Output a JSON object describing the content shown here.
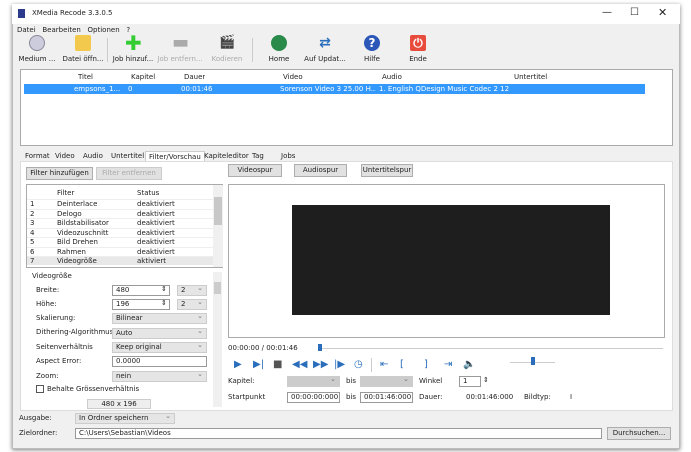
{
  "window": {
    "title": "XMedia Recode 3.3.0.5"
  },
  "menu": [
    "Datei",
    "Bearbeiten",
    "Optionen",
    "?"
  ],
  "toolbar": [
    {
      "label": "Medium ...",
      "icon": "disc-icon",
      "enabled": true
    },
    {
      "label": "Datei öffn...",
      "icon": "folder-open-icon",
      "enabled": true
    },
    {
      "label": "Job hinzuf...",
      "icon": "plus-icon",
      "enabled": true
    },
    {
      "label": "Job entfern...",
      "icon": "minus-icon",
      "enabled": false
    },
    {
      "label": "Kodieren",
      "icon": "film-encode-icon",
      "enabled": false
    },
    {
      "label": "Home",
      "icon": "globe-icon",
      "enabled": true
    },
    {
      "label": "Auf Updat...",
      "icon": "refresh-icon",
      "enabled": true
    },
    {
      "label": "Hilfe",
      "icon": "help-icon",
      "enabled": true
    },
    {
      "label": "Ende",
      "icon": "power-icon",
      "enabled": true
    }
  ],
  "filelist": {
    "columns": [
      "Titel",
      "Kapitel",
      "Dauer",
      "Video",
      "Audio",
      "Untertitel"
    ],
    "rows": [
      [
        "empsons_1...",
        "0",
        "00:01:46",
        "Sorenson Video 3 25.00 H...",
        "1. English QDesign Music Codec 2 12...",
        ""
      ]
    ]
  },
  "tabs": [
    "Format",
    "Video",
    "Audio",
    "Untertitel",
    "Filter/Vorschau",
    "Kapiteleditor",
    "Tag",
    "Jobs"
  ],
  "active_tab": "Filter/Vorschau",
  "filter": {
    "add_label": "Filter hinzufügen",
    "remove_label": "Filter entfernen",
    "columns": [
      "Filter",
      "Status"
    ],
    "rows": [
      [
        "1",
        "Deinterlace",
        "deaktiviert"
      ],
      [
        "2",
        "Delogo",
        "deaktiviert"
      ],
      [
        "3",
        "Bildstabilisator",
        "deaktiviert"
      ],
      [
        "4",
        "Videozuschnitt",
        "deaktiviert"
      ],
      [
        "5",
        "Bild Drehen",
        "deaktiviert"
      ],
      [
        "6",
        "Rahmen",
        "deaktiviert"
      ],
      [
        "7",
        "Videogröße",
        "aktiviert"
      ]
    ]
  },
  "videosize": {
    "title": "Videogröße",
    "width_label": "Breite:",
    "width": "480",
    "width_div": "2",
    "height_label": "Höhe:",
    "height": "196",
    "height_div": "2",
    "scaling_label": "Skalierung:",
    "scaling": "Bilinear",
    "dither_label": "Dithering-Algorithmus",
    "dither": "Auto",
    "aspect_label": "Seitenverhältnis",
    "aspect": "Keep original",
    "aspect_error_label": "Aspect Error:",
    "aspect_error": "0.0000",
    "zoom_label": "Zoom:",
    "zoom": "nein",
    "keep_ratio_label": "Behalte Grössenverhältnis",
    "keep_ratio": false,
    "result": "480 x 196"
  },
  "preview": {
    "track_buttons": [
      "Videospur",
      "Audiospur",
      "Untertitelspur"
    ],
    "time": "00:00:00 / 00:01:46",
    "seek_percent": 0,
    "volume_percent": 50,
    "chapter_label": "Kapitel:",
    "to_label": "bis",
    "angle_label": "Winkel",
    "angle": "1",
    "start_label": "Startpunkt",
    "start": "00:00:00:000",
    "end": "00:01:46:000",
    "duration_label": "Dauer:",
    "duration": "00:01:46:000",
    "frametype_label": "Bildtyp:",
    "frametype": "I"
  },
  "output": {
    "label": "Ausgabe:",
    "value": "In Ordner speichern",
    "folder_label": "Zielordner:",
    "folder": "C:\\Users\\Sebastian\\Videos",
    "browse_label": "Durchsuchen..."
  },
  "colors": {
    "selection": "#3399ff",
    "accent": "#2a6ebb"
  }
}
